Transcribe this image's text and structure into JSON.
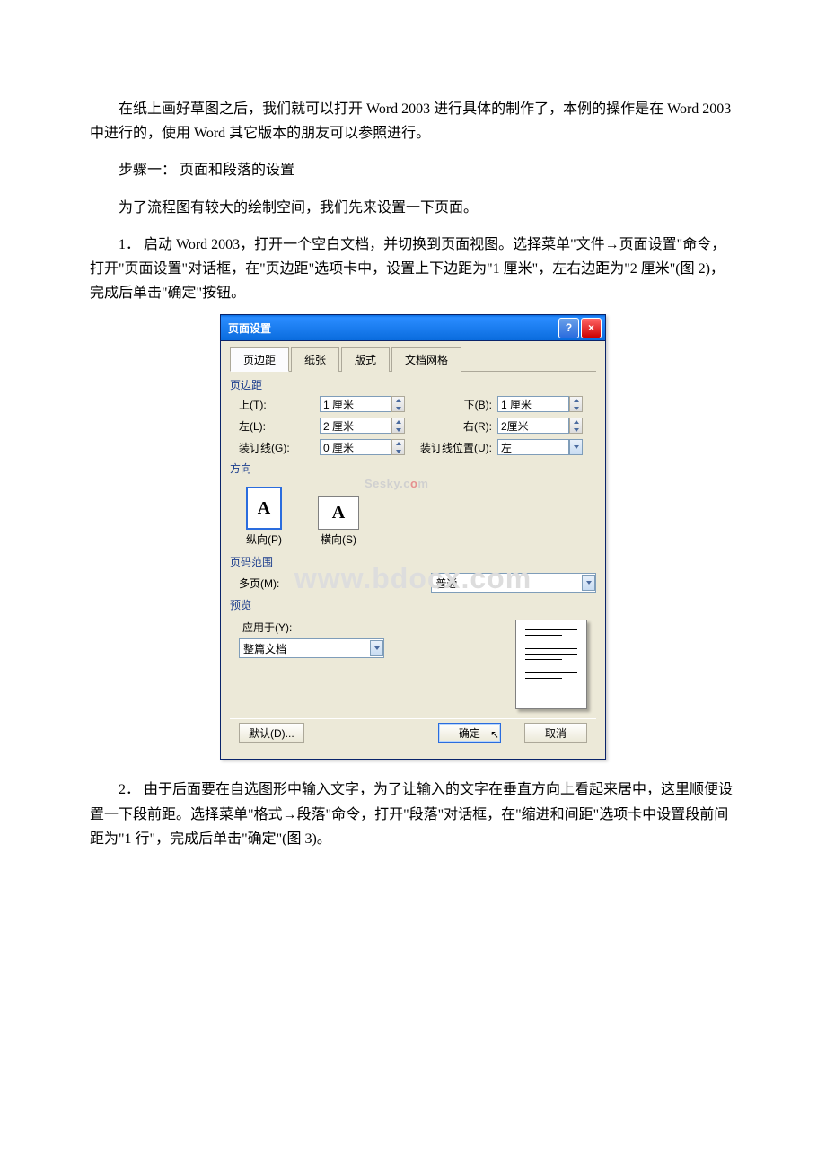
{
  "paragraphs": {
    "p1": "在纸上画好草图之后，我们就可以打开 Word 2003 进行具体的制作了，本例的操作是在 Word 2003 中进行的，使用 Word 其它版本的朋友可以参照进行。",
    "p2": "步骤一：  页面和段落的设置",
    "p3": "为了流程图有较大的绘制空间，我们先来设置一下页面。",
    "p4": "1．  启动 Word 2003，打开一个空白文档，并切换到页面视图。选择菜单\"文件→页面设置\"命令，打开\"页面设置\"对话框，在\"页边距\"选项卡中，设置上下边距为\"1 厘米\"，左右边距为\"2 厘米\"(图 2)，完成后单击\"确定\"按钮。",
    "p5": "2．  由于后面要在自选图形中输入文字，为了让输入的文字在垂直方向上看起来居中，这里顺便设置一下段前距。选择菜单\"格式→段落\"命令，打开\"段落\"对话框，在\"缩进和间距\"选项卡中设置段前间距为\"1 行\"，完成后单击\"确定\"(图 3)。"
  },
  "dialog": {
    "title": "页面设置",
    "help": "?",
    "close": "×",
    "tabs": [
      "页边距",
      "纸张",
      "版式",
      "文档网格"
    ],
    "margins_label": "页边距",
    "top_lbl": "上(T):",
    "top_val": "1 厘米",
    "bottom_lbl": "下(B):",
    "bottom_val": "1 厘米",
    "left_lbl": "左(L):",
    "left_val": "2 厘米",
    "right_lbl": "右(R):",
    "right_val": "2厘米",
    "gutter_lbl": "装订线(G):",
    "gutter_val": "0 厘米",
    "gutter_pos_lbl": "装订线位置(U):",
    "gutter_pos_val": "左",
    "orient_label": "方向",
    "portrait": "纵向(P)",
    "landscape": "横向(S)",
    "A": "A",
    "wm_small_1": "S",
    "wm_small_2": "esky.c",
    "wm_small_3": "m",
    "range_label": "页码范围",
    "multi_lbl": "多页(M):",
    "multi_val": "普通",
    "preview_label": "预览",
    "apply_lbl": "应用于(Y):",
    "apply_val": "整篇文档",
    "default_btn": "默认(D)...",
    "ok_btn": "确定",
    "cancel_btn": "取消"
  },
  "watermark": {
    "big": "www.bdocx.com"
  }
}
